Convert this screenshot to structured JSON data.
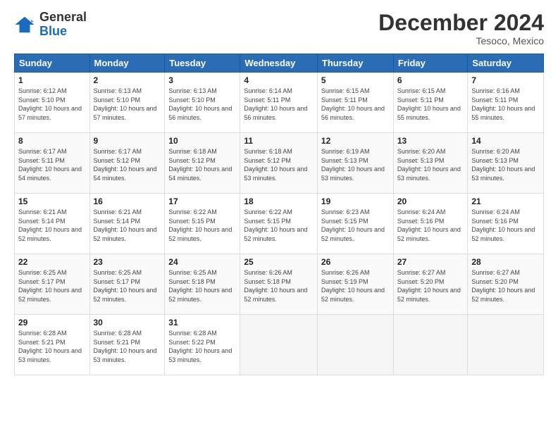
{
  "logo": {
    "general": "General",
    "blue": "Blue"
  },
  "header": {
    "month": "December 2024",
    "location": "Tesoco, Mexico"
  },
  "days_of_week": [
    "Sunday",
    "Monday",
    "Tuesday",
    "Wednesday",
    "Thursday",
    "Friday",
    "Saturday"
  ],
  "weeks": [
    [
      {
        "day": "1",
        "sunrise": "6:12 AM",
        "sunset": "5:10 PM",
        "daylight": "10 hours and 57 minutes."
      },
      {
        "day": "2",
        "sunrise": "6:13 AM",
        "sunset": "5:10 PM",
        "daylight": "10 hours and 57 minutes."
      },
      {
        "day": "3",
        "sunrise": "6:13 AM",
        "sunset": "5:10 PM",
        "daylight": "10 hours and 56 minutes."
      },
      {
        "day": "4",
        "sunrise": "6:14 AM",
        "sunset": "5:11 PM",
        "daylight": "10 hours and 56 minutes."
      },
      {
        "day": "5",
        "sunrise": "6:15 AM",
        "sunset": "5:11 PM",
        "daylight": "10 hours and 56 minutes."
      },
      {
        "day": "6",
        "sunrise": "6:15 AM",
        "sunset": "5:11 PM",
        "daylight": "10 hours and 55 minutes."
      },
      {
        "day": "7",
        "sunrise": "6:16 AM",
        "sunset": "5:11 PM",
        "daylight": "10 hours and 55 minutes."
      }
    ],
    [
      {
        "day": "8",
        "sunrise": "6:17 AM",
        "sunset": "5:11 PM",
        "daylight": "10 hours and 54 minutes."
      },
      {
        "day": "9",
        "sunrise": "6:17 AM",
        "sunset": "5:12 PM",
        "daylight": "10 hours and 54 minutes."
      },
      {
        "day": "10",
        "sunrise": "6:18 AM",
        "sunset": "5:12 PM",
        "daylight": "10 hours and 54 minutes."
      },
      {
        "day": "11",
        "sunrise": "6:18 AM",
        "sunset": "5:12 PM",
        "daylight": "10 hours and 53 minutes."
      },
      {
        "day": "12",
        "sunrise": "6:19 AM",
        "sunset": "5:13 PM",
        "daylight": "10 hours and 53 minutes."
      },
      {
        "day": "13",
        "sunrise": "6:20 AM",
        "sunset": "5:13 PM",
        "daylight": "10 hours and 53 minutes."
      },
      {
        "day": "14",
        "sunrise": "6:20 AM",
        "sunset": "5:13 PM",
        "daylight": "10 hours and 53 minutes."
      }
    ],
    [
      {
        "day": "15",
        "sunrise": "6:21 AM",
        "sunset": "5:14 PM",
        "daylight": "10 hours and 52 minutes."
      },
      {
        "day": "16",
        "sunrise": "6:21 AM",
        "sunset": "5:14 PM",
        "daylight": "10 hours and 52 minutes."
      },
      {
        "day": "17",
        "sunrise": "6:22 AM",
        "sunset": "5:15 PM",
        "daylight": "10 hours and 52 minutes."
      },
      {
        "day": "18",
        "sunrise": "6:22 AM",
        "sunset": "5:15 PM",
        "daylight": "10 hours and 52 minutes."
      },
      {
        "day": "19",
        "sunrise": "6:23 AM",
        "sunset": "5:15 PM",
        "daylight": "10 hours and 52 minutes."
      },
      {
        "day": "20",
        "sunrise": "6:24 AM",
        "sunset": "5:16 PM",
        "daylight": "10 hours and 52 minutes."
      },
      {
        "day": "21",
        "sunrise": "6:24 AM",
        "sunset": "5:16 PM",
        "daylight": "10 hours and 52 minutes."
      }
    ],
    [
      {
        "day": "22",
        "sunrise": "6:25 AM",
        "sunset": "5:17 PM",
        "daylight": "10 hours and 52 minutes."
      },
      {
        "day": "23",
        "sunrise": "6:25 AM",
        "sunset": "5:17 PM",
        "daylight": "10 hours and 52 minutes."
      },
      {
        "day": "24",
        "sunrise": "6:25 AM",
        "sunset": "5:18 PM",
        "daylight": "10 hours and 52 minutes."
      },
      {
        "day": "25",
        "sunrise": "6:26 AM",
        "sunset": "5:18 PM",
        "daylight": "10 hours and 52 minutes."
      },
      {
        "day": "26",
        "sunrise": "6:26 AM",
        "sunset": "5:19 PM",
        "daylight": "10 hours and 52 minutes."
      },
      {
        "day": "27",
        "sunrise": "6:27 AM",
        "sunset": "5:20 PM",
        "daylight": "10 hours and 52 minutes."
      },
      {
        "day": "28",
        "sunrise": "6:27 AM",
        "sunset": "5:20 PM",
        "daylight": "10 hours and 52 minutes."
      }
    ],
    [
      {
        "day": "29",
        "sunrise": "6:28 AM",
        "sunset": "5:21 PM",
        "daylight": "10 hours and 53 minutes."
      },
      {
        "day": "30",
        "sunrise": "6:28 AM",
        "sunset": "5:21 PM",
        "daylight": "10 hours and 53 minutes."
      },
      {
        "day": "31",
        "sunrise": "6:28 AM",
        "sunset": "5:22 PM",
        "daylight": "10 hours and 53 minutes."
      },
      null,
      null,
      null,
      null
    ]
  ]
}
